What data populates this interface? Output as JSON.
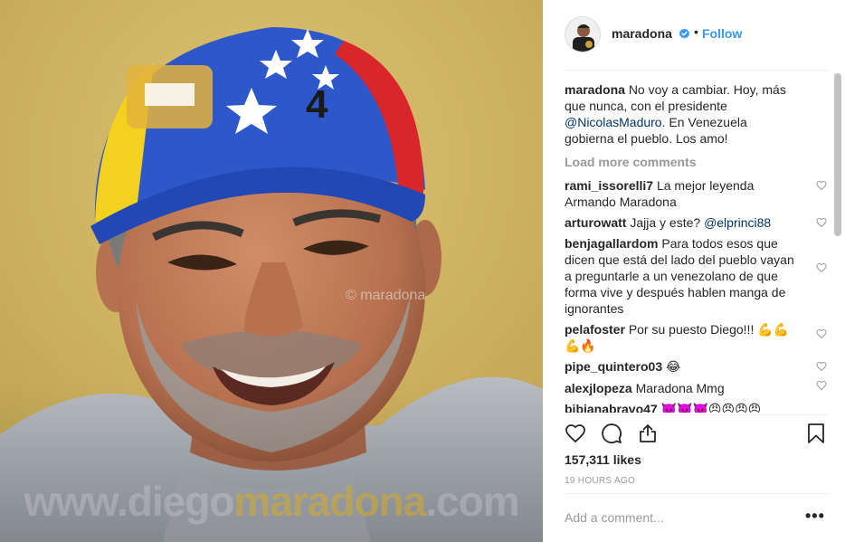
{
  "post": {
    "username": "maradona",
    "follow_label": "Follow",
    "separator": "•",
    "photo_watermark_mid": "© maradona",
    "photo_watermark_bottom_prefix": "www.diego",
    "photo_watermark_bottom_accent": "maradona",
    "photo_watermark_bottom_suffix": ".com",
    "caption": {
      "user": "maradona",
      "text_a": "No voy a cambiar. Hoy, más que nunca, con el presidente ",
      "mention": "@NicolasMaduro",
      "text_b": ". En Venezuela gobierna el pueblo. Los amo!"
    },
    "load_more": "Load more comments",
    "comments": [
      {
        "user": "rami_issorelli7",
        "text": "La mejor leyenda Armando Maradona"
      },
      {
        "user": "arturowatt",
        "text": "Jajja y este?",
        "mention": "@elprinci88"
      },
      {
        "user": "benjagallardom",
        "text": "Para todos esos que dicen que está del lado del pueblo vayan a preguntarle a un venezolano de que forma vive y después hablen manga de ignorantes"
      },
      {
        "user": "pelafoster",
        "text": "Por su puesto Diego!!! 💪💪💪🔥"
      },
      {
        "user": "pipe_quintero03",
        "text": "😂"
      },
      {
        "user": "alexjlopeza",
        "text": "Maradona Mmg"
      },
      {
        "user": "bibianabravo47",
        "text": "👿👿👿😠😠😠😠"
      }
    ],
    "likes": "157,311 likes",
    "time": "19 HOURS AGO",
    "add_comment_placeholder": "Add a comment...",
    "more_options": "•••"
  },
  "colors": {
    "link_blue": "#3897f0",
    "mention_blue": "#003569",
    "muted": "#999999",
    "text": "#262626"
  },
  "icons": [
    "verified-badge-icon",
    "heart-icon",
    "comment-icon",
    "share-icon",
    "bookmark-icon",
    "more-options-icon"
  ]
}
